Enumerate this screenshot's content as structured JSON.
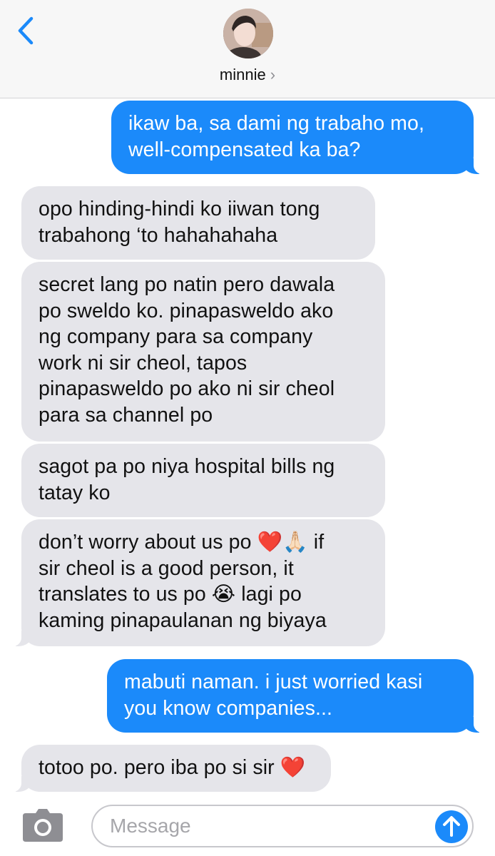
{
  "header": {
    "contact_name": "minnie",
    "chevron": "›"
  },
  "messages": [
    {
      "side": "sent",
      "text": "ikaw ba, sa dami ng trabaho mo,\nwell-compensated ka ba?"
    },
    {
      "side": "received",
      "text": "opo hinding-hindi ko iiwan tong\ntrabahong ‘to hahahahaha"
    },
    {
      "side": "received",
      "text": "secret lang po natin pero dawala\npo sweldo ko. pinapasweldo ako\nng company para sa company\nwork ni sir cheol, tapos\npinapasweldo po ako ni sir cheol\npara sa channel po"
    },
    {
      "side": "received",
      "text": "sagot pa po niya hospital bills ng\ntatay ko"
    },
    {
      "side": "received",
      "text": "don’t worry about us po ❤️🙏🏻 if\nsir cheol is a good person, it\ntranslates to us po 😭 lagi po\nkaming pinapaulanan ng biyaya"
    },
    {
      "side": "sent",
      "text": "mabuti naman. i just worried kasi\nyou know companies..."
    },
    {
      "side": "received",
      "text": "totoo po. pero iba po si sir ❤️"
    }
  ],
  "composer": {
    "placeholder": "Message",
    "value": ""
  },
  "colors": {
    "sent_bubble": "#1b8afa",
    "received_bubble": "#e5e5ea",
    "accent": "#1b8afa"
  },
  "icons": {
    "back": "chevron-left-icon",
    "camera": "camera-icon",
    "send": "arrow-up-icon"
  }
}
